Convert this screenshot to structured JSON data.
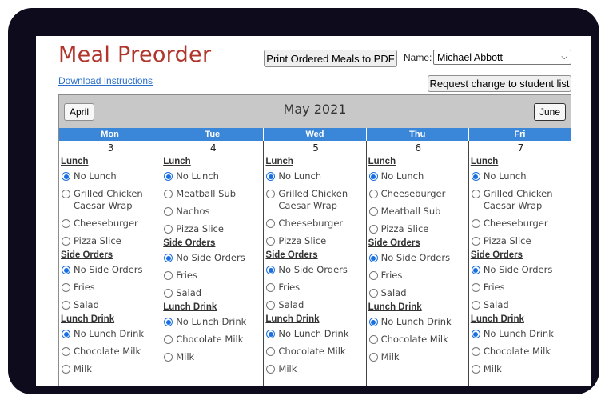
{
  "page": {
    "title": "Meal Preorder",
    "download_link": "Download Instructions",
    "print_button": "Print Ordered Meals to PDF",
    "name_label": "Name:",
    "name_value": "Michael Abbott",
    "request_button": "Request change to student list"
  },
  "calendar": {
    "month": "May 2021",
    "prev_label": "April",
    "next_label": "June",
    "colors": {
      "header_bg": "#c8c8c8",
      "day_bar": "#3a86d8",
      "title": "#b0362c",
      "radio": "#1a6fe0"
    },
    "days": [
      {
        "name": "Mon",
        "date": "3",
        "sections": [
          {
            "title": "Lunch",
            "options": [
              {
                "label": "No Lunch",
                "selected": true
              },
              {
                "label": "Grilled Chicken Caesar Wrap",
                "selected": false
              },
              {
                "label": "Cheeseburger",
                "selected": false
              },
              {
                "label": "Pizza Slice",
                "selected": false
              }
            ]
          },
          {
            "title": "Side Orders",
            "options": [
              {
                "label": "No Side Orders",
                "selected": true
              },
              {
                "label": "Fries",
                "selected": false
              },
              {
                "label": "Salad",
                "selected": false
              }
            ]
          },
          {
            "title": "Lunch Drink",
            "options": [
              {
                "label": "No Lunch Drink",
                "selected": true
              },
              {
                "label": "Chocolate Milk",
                "selected": false
              },
              {
                "label": "Milk",
                "selected": false
              }
            ]
          }
        ]
      },
      {
        "name": "Tue",
        "date": "4",
        "sections": [
          {
            "title": "Lunch",
            "options": [
              {
                "label": "No Lunch",
                "selected": true
              },
              {
                "label": "Meatball Sub",
                "selected": false
              },
              {
                "label": "Nachos",
                "selected": false
              },
              {
                "label": "Pizza Slice",
                "selected": false
              }
            ]
          },
          {
            "title": "Side Orders",
            "options": [
              {
                "label": "No Side Orders",
                "selected": true
              },
              {
                "label": "Fries",
                "selected": false
              },
              {
                "label": "Salad",
                "selected": false
              }
            ]
          },
          {
            "title": "Lunch Drink",
            "options": [
              {
                "label": "No Lunch Drink",
                "selected": true
              },
              {
                "label": "Chocolate Milk",
                "selected": false
              },
              {
                "label": "Milk",
                "selected": false
              }
            ]
          }
        ]
      },
      {
        "name": "Wed",
        "date": "5",
        "sections": [
          {
            "title": "Lunch",
            "options": [
              {
                "label": "No Lunch",
                "selected": true
              },
              {
                "label": "Grilled Chicken Caesar Wrap",
                "selected": false
              },
              {
                "label": "Cheeseburger",
                "selected": false
              },
              {
                "label": "Pizza Slice",
                "selected": false
              }
            ]
          },
          {
            "title": "Side Orders",
            "options": [
              {
                "label": "No Side Orders",
                "selected": true
              },
              {
                "label": "Fries",
                "selected": false
              },
              {
                "label": "Salad",
                "selected": false
              }
            ]
          },
          {
            "title": "Lunch Drink",
            "options": [
              {
                "label": "No Lunch Drink",
                "selected": true
              },
              {
                "label": "Chocolate Milk",
                "selected": false
              },
              {
                "label": "Milk",
                "selected": false
              }
            ]
          }
        ]
      },
      {
        "name": "Thu",
        "date": "6",
        "sections": [
          {
            "title": "Lunch",
            "options": [
              {
                "label": "No Lunch",
                "selected": true
              },
              {
                "label": "Cheeseburger",
                "selected": false
              },
              {
                "label": "Meatball Sub",
                "selected": false
              },
              {
                "label": "Pizza Slice",
                "selected": false
              }
            ]
          },
          {
            "title": "Side Orders",
            "options": [
              {
                "label": "No Side Orders",
                "selected": true
              },
              {
                "label": "Fries",
                "selected": false
              },
              {
                "label": "Salad",
                "selected": false
              }
            ]
          },
          {
            "title": "Lunch Drink",
            "options": [
              {
                "label": "No Lunch Drink",
                "selected": true
              },
              {
                "label": "Chocolate Milk",
                "selected": false
              },
              {
                "label": "Milk",
                "selected": false
              }
            ]
          }
        ]
      },
      {
        "name": "Fri",
        "date": "7",
        "sections": [
          {
            "title": "Lunch",
            "options": [
              {
                "label": "No Lunch",
                "selected": true
              },
              {
                "label": "Grilled Chicken Caesar Wrap",
                "selected": false
              },
              {
                "label": "Cheeseburger",
                "selected": false
              },
              {
                "label": "Pizza Slice",
                "selected": false
              }
            ]
          },
          {
            "title": "Side Orders",
            "options": [
              {
                "label": "No Side Orders",
                "selected": true
              },
              {
                "label": "Fries",
                "selected": false
              },
              {
                "label": "Salad",
                "selected": false
              }
            ]
          },
          {
            "title": "Lunch Drink",
            "options": [
              {
                "label": "No Lunch Drink",
                "selected": true
              },
              {
                "label": "Chocolate Milk",
                "selected": false
              },
              {
                "label": "Milk",
                "selected": false
              }
            ]
          }
        ]
      }
    ]
  }
}
